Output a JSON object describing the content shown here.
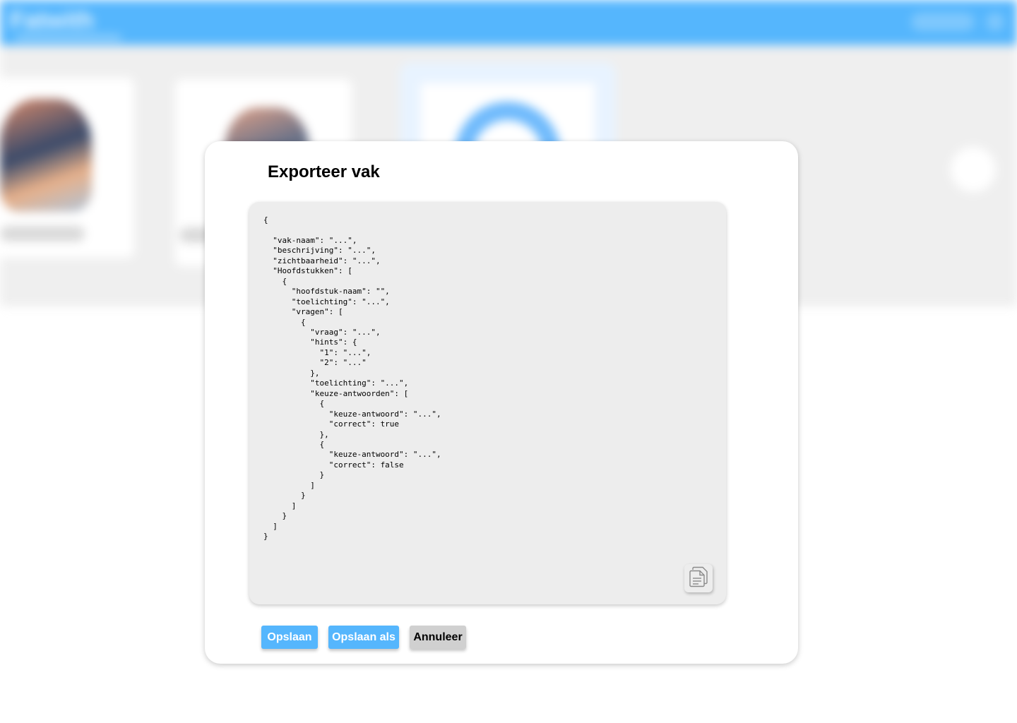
{
  "background": {
    "logo_text": "Fatwith"
  },
  "dialog": {
    "title": "Exporteer vak",
    "code": "{\n\n  \"vak-naam\": \"...\",\n  \"beschrijving\": \"...\",\n  \"zichtbaarheid\": \"...\",\n  \"Hoofdstukken\": [\n    {\n      \"hoofdstuk-naam\": \"\",\n      \"toelichting\": \"...\",\n      \"vragen\": [\n        {\n          \"vraag\": \"...\",\n          \"hints\": {\n            \"1\": \"...\",\n            \"2\": \"...\"\n          },\n          \"toelichting\": \"...\",\n          \"keuze-antwoorden\": [\n            {\n              \"keuze-antwoord\": \"...\",\n              \"correct\": true\n            },\n            {\n              \"keuze-antwoord\": \"...\",\n              \"correct\": false\n            }\n          ]\n        }\n      ]\n    }\n  ]\n}",
    "copy_icon": "copy-icon",
    "buttons": {
      "save": "Opslaan",
      "save_as": "Opslaan als",
      "cancel": "Annuleer"
    }
  },
  "colors": {
    "primary": "#55b6fd",
    "code_background": "#ededed",
    "cancel_button": "#d0d0d0"
  }
}
